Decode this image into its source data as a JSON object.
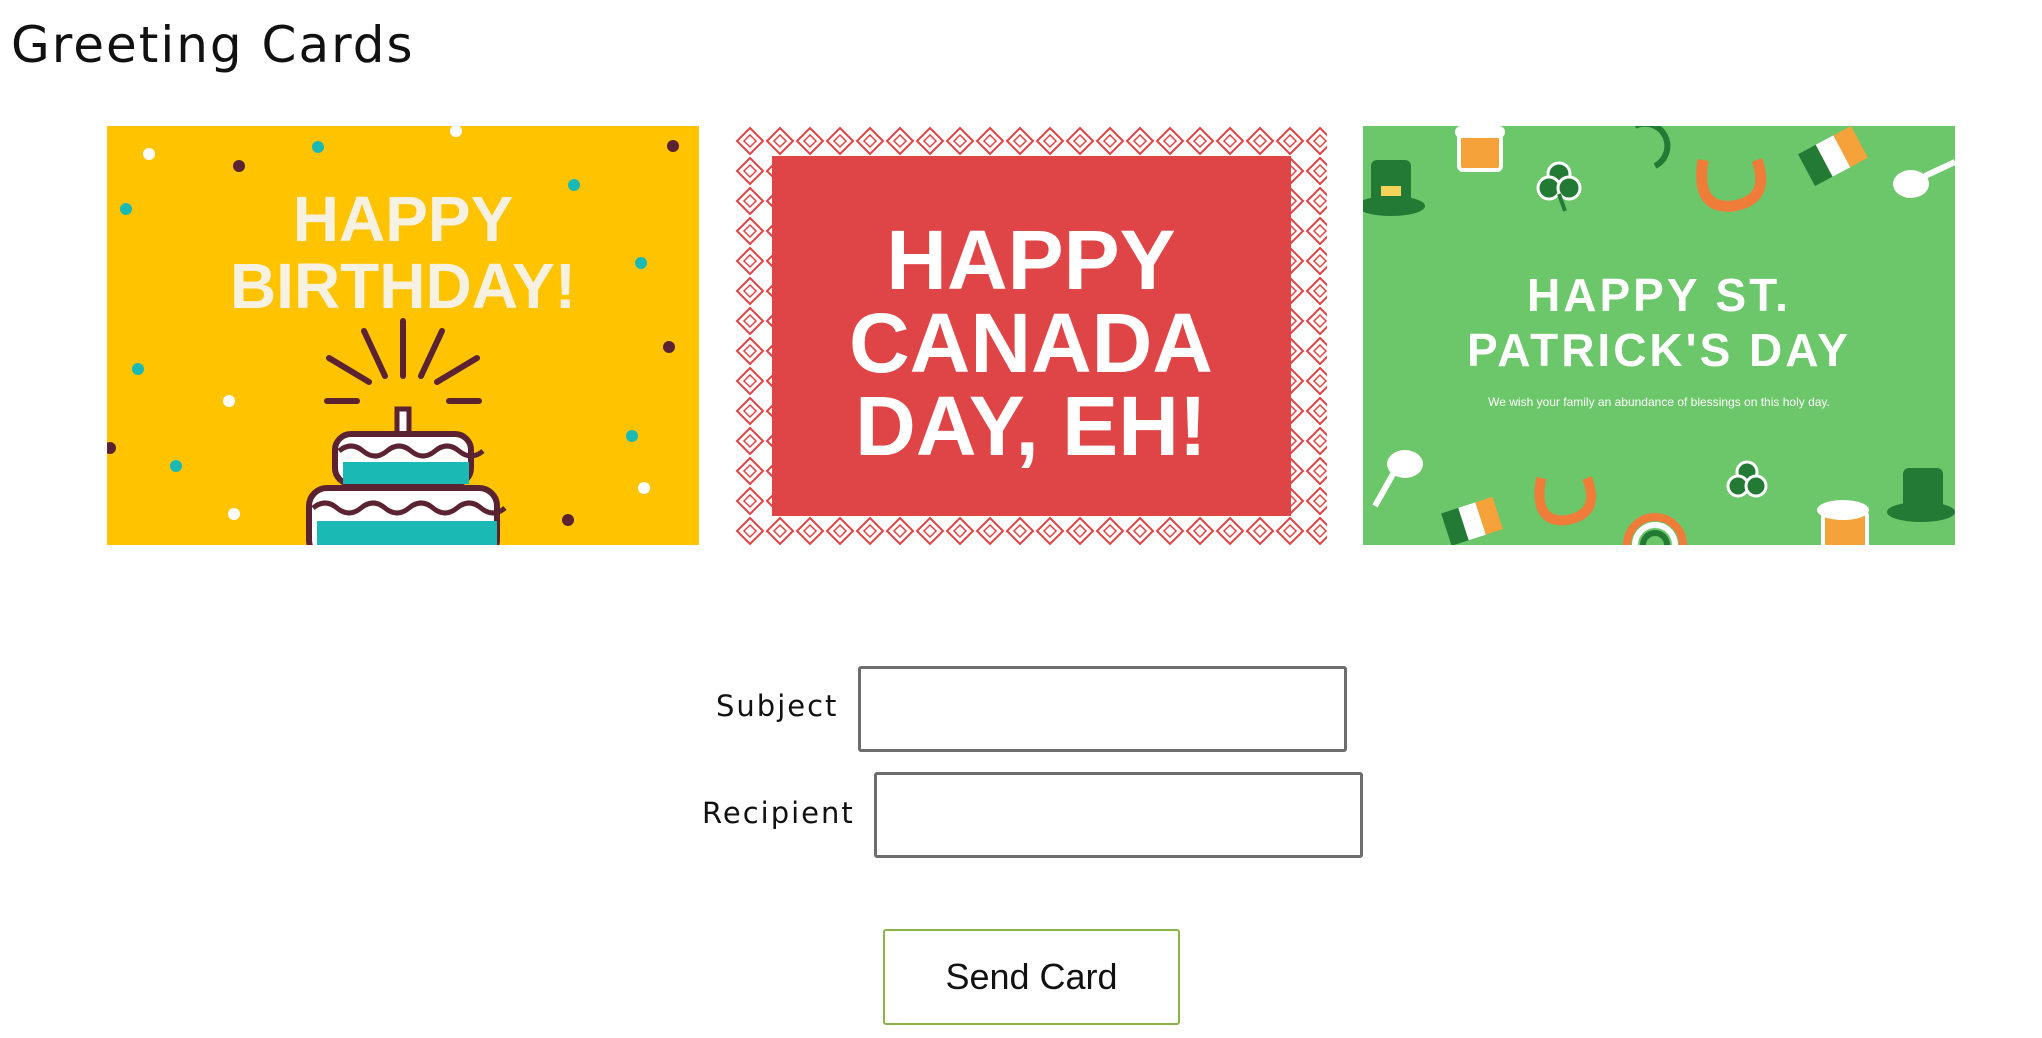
{
  "page": {
    "title": "Greeting Cards"
  },
  "cards": [
    {
      "name": "birthday",
      "lines": [
        "HAPPY",
        "BIRTHDAY!"
      ],
      "background": "#ffc300",
      "text_color": "#f7f1e1"
    },
    {
      "name": "canada",
      "lines": [
        "HAPPY",
        "CANADA",
        "DAY, EH!"
      ],
      "background": "#df4446",
      "text_color": "#ffffff"
    },
    {
      "name": "st-patricks",
      "lines": [
        "HAPPY ST.",
        "PATRICK'S DAY"
      ],
      "subtitle": "We wish your family an abundance of blessings on this holy day.",
      "background": "#6cc66a",
      "text_color": "#ffffff"
    }
  ],
  "form": {
    "subject_label": "Subject",
    "subject_value": "",
    "recipient_label": "Recipient",
    "recipient_value": "",
    "send_label": "Send Card"
  },
  "colors": {
    "button_border": "#8bb34a",
    "input_border": "#6d6d6d"
  }
}
